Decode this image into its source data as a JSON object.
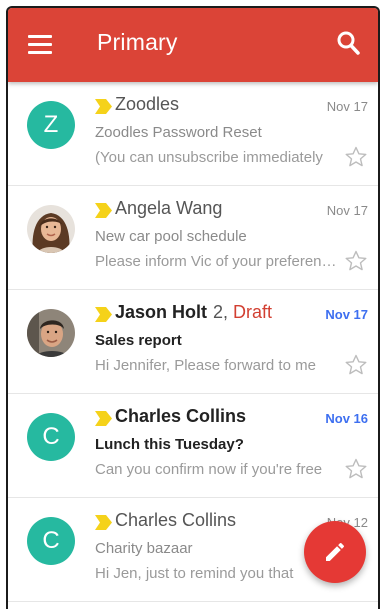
{
  "appbar": {
    "title": "Primary",
    "background": "#db4437",
    "menu_icon": "hamburger-menu-icon",
    "search_icon": "search-icon"
  },
  "emails": [
    {
      "sender": "Zoodles",
      "count": "",
      "draft": "",
      "date": "Nov 17",
      "subject": "Zoodles Password Reset",
      "snippet": "(You can unsubscribe immediately",
      "unread": false,
      "avatar": {
        "type": "letter",
        "letter": "Z",
        "color": "#26b9a0"
      }
    },
    {
      "sender": "Angela Wang",
      "count": "",
      "draft": "",
      "date": "Nov 17",
      "subject": "New car pool schedule",
      "snippet": "Please inform Vic of your preferences",
      "unread": false,
      "avatar": {
        "type": "photo",
        "letter": ""
      }
    },
    {
      "sender": "Jason Holt",
      "count": "2,",
      "draft": "Draft",
      "date": "Nov 17",
      "subject": "Sales report",
      "snippet": "Hi Jennifer, Please forward to me",
      "unread": true,
      "avatar": {
        "type": "photo",
        "letter": ""
      }
    },
    {
      "sender": "Charles Collins",
      "count": "",
      "draft": "",
      "date": "Nov 16",
      "subject": "Lunch this Tuesday?",
      "snippet": "Can you confirm now if you're free",
      "unread": true,
      "avatar": {
        "type": "letter",
        "letter": "C",
        "color": "#26b9a0"
      }
    },
    {
      "sender": "Charles Collins",
      "count": "",
      "draft": "",
      "date": "Nov 12",
      "subject": "Charity bazaar",
      "snippet": "Hi Jen, just to remind you that",
      "unread": false,
      "avatar": {
        "type": "letter",
        "letter": "C",
        "color": "#26b9a0"
      }
    }
  ],
  "colors": {
    "unread_date": "#3d6ff0",
    "draft": "#d23f31",
    "importance_marker": "#f5d21a",
    "fab": "#e53935"
  },
  "fab": {
    "icon": "pencil-compose-icon"
  }
}
